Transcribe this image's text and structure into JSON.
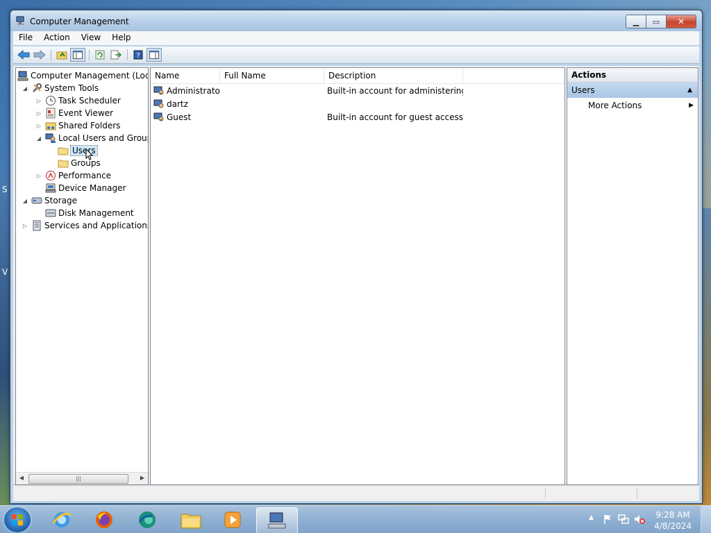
{
  "window": {
    "title": "Computer Management"
  },
  "menu": [
    "File",
    "Action",
    "View",
    "Help"
  ],
  "tree": {
    "root": "Computer Management (Local",
    "system_tools": "System Tools",
    "task_scheduler": "Task Scheduler",
    "event_viewer": "Event Viewer",
    "shared_folders": "Shared Folders",
    "local_users_groups": "Local Users and Groups",
    "users": "Users",
    "groups": "Groups",
    "performance": "Performance",
    "device_manager": "Device Manager",
    "storage": "Storage",
    "disk_management": "Disk Management",
    "services_apps": "Services and Applications"
  },
  "list": {
    "columns": [
      "Name",
      "Full Name",
      "Description"
    ],
    "rows": [
      {
        "name": "Administrator",
        "full_name": "",
        "description": "Built-in account for administering..."
      },
      {
        "name": "dartz",
        "full_name": "",
        "description": ""
      },
      {
        "name": "Guest",
        "full_name": "",
        "description": "Built-in account for guest access t..."
      }
    ]
  },
  "actions": {
    "header": "Actions",
    "section": "Users",
    "more_actions": "More Actions"
  },
  "desktop": {
    "left_letter_1": "S",
    "left_letter_2": "V"
  },
  "clock": {
    "time": "9:28 AM",
    "date": "4/8/2024"
  }
}
